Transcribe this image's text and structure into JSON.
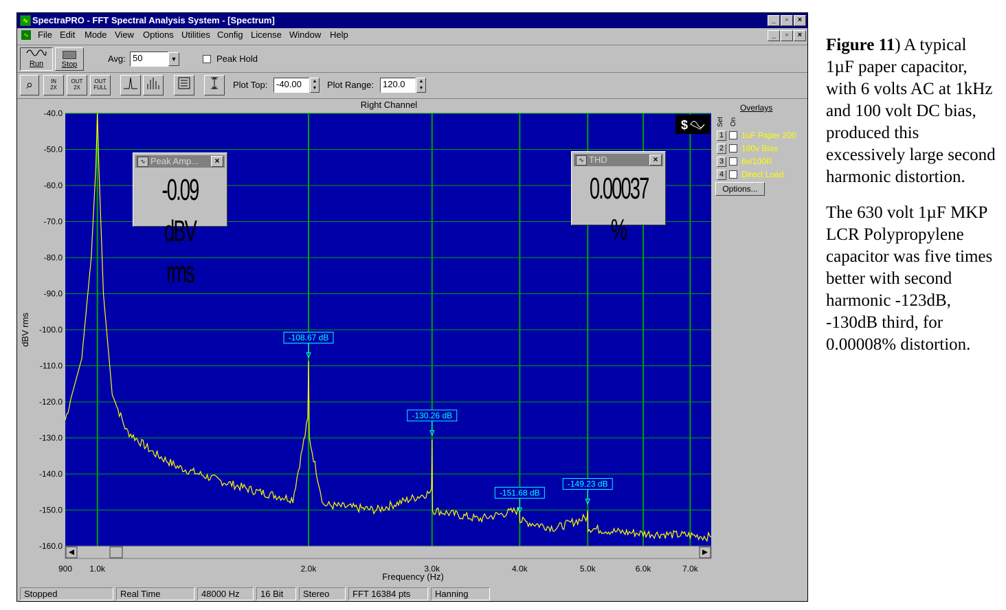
{
  "window": {
    "title": "SpectraPRO - FFT Spectral Analysis System - [Spectrum]",
    "caption_buttons": [
      "_",
      "▫",
      "×"
    ]
  },
  "menu": [
    "File",
    "Edit",
    "Mode",
    "View",
    "Options",
    "Utilities",
    "Config",
    "License",
    "Window",
    "Help"
  ],
  "toolbar1": {
    "run_label": "Run",
    "stop_label": "Stop",
    "avg_label": "Avg:",
    "avg_value": "50",
    "peak_hold_label": "Peak Hold"
  },
  "toolbar2": {
    "zoom_in_label": "IN\n2X",
    "zoom_out_label": "OUT\n2X",
    "full_label": "OUT\nFULL",
    "plot_top_label": "Plot Top:",
    "plot_top_value": "-40.00",
    "plot_range_label": "Plot Range:",
    "plot_range_value": "120.0"
  },
  "plot": {
    "channel_label": "Right Channel",
    "ylabel": "dBV rms",
    "xlabel": "Frequency (Hz)",
    "y_ticks": [
      "-40.0",
      "-50.0",
      "-60.0",
      "-70.0",
      "-80.0",
      "-90.0",
      "-100.0",
      "-110.0",
      "-120.0",
      "-130.0",
      "-140.0",
      "-150.0",
      "-160.0"
    ],
    "x_ticks": [
      "900",
      "1.0k",
      "2.0k",
      "3.0k",
      "4.0k",
      "5.0k",
      "6.0k",
      "7.0k"
    ],
    "colors": {
      "background": "#0000a8",
      "trace": "#ffff00",
      "grid": "#00a000",
      "marker": "#00ffff"
    }
  },
  "chart_data": {
    "type": "line",
    "title": "Right Channel",
    "xlabel": "Frequency (Hz)",
    "ylabel": "dBV rms",
    "xscale": "log",
    "xlim": [
      900,
      7500
    ],
    "ylim": [
      -160,
      -40
    ],
    "grid": true,
    "series": [
      {
        "x": [
          900,
          920,
          950,
          980,
          995,
          1000,
          1005,
          1020,
          1050,
          1100,
          1200,
          1300,
          1500,
          1700,
          1900,
          1995,
          2000,
          2005,
          2100,
          2500,
          2995,
          3000,
          3005,
          3500,
          3995,
          4000,
          4005,
          4500,
          4995,
          5000,
          5005,
          5500,
          6000,
          7000,
          7500
        ],
        "y": [
          -125,
          -118,
          -108,
          -80,
          -55,
          -40,
          -55,
          -90,
          -118,
          -128,
          -134,
          -138,
          -142,
          -145,
          -147,
          -125,
          -108.67,
          -130,
          -148.5,
          -150,
          -145,
          -130.26,
          -150,
          -152.5,
          -150,
          -151.68,
          -153,
          -155,
          -152,
          -149.23,
          -155,
          -156,
          -156.5,
          -157,
          -157.5
        ]
      }
    ],
    "annotations": [
      {
        "x": 2000,
        "y": -108.67,
        "text": "-108.67 dB"
      },
      {
        "x": 3000,
        "y": -130.26,
        "text": "-130.26 dB"
      },
      {
        "x": 4000,
        "y": -151.68,
        "text": "-151.68 dB"
      },
      {
        "x": 5000,
        "y": -149.23,
        "text": "-149.23 dB"
      }
    ]
  },
  "readouts": {
    "peak_title": "Peak Amp...",
    "peak_value": "-0.09 dBV rms",
    "thd_title": "THD",
    "thd_value": "0.00037 %"
  },
  "overlays": {
    "title": "Overlays",
    "col_set": "Set",
    "col_on": "On",
    "items": [
      {
        "num": "1",
        "label": "1uF Paper 200"
      },
      {
        "num": "2",
        "label": "100v Bias"
      },
      {
        "num": "3",
        "label": "6v/100R"
      },
      {
        "num": "4",
        "label": "Direct Load"
      }
    ],
    "options_label": "Options..."
  },
  "status": [
    "Stopped",
    "Real Time",
    "48000 Hz",
    "16 Bit",
    "Stereo",
    "FFT 16384 pts",
    "Hanning"
  ],
  "caption": {
    "fig_label": "Figure 11",
    "para1": ") A typical 1µF paper capacitor, with 6 volts AC at 1kHz and 100 volt DC bias, produced this excessively large second harmonic distortion.",
    "para2": "The 630 volt 1µF MKP LCR Polypropylene capacitor was five times better with second harmonic -123dB, -130dB third, for 0.00008% distortion."
  }
}
